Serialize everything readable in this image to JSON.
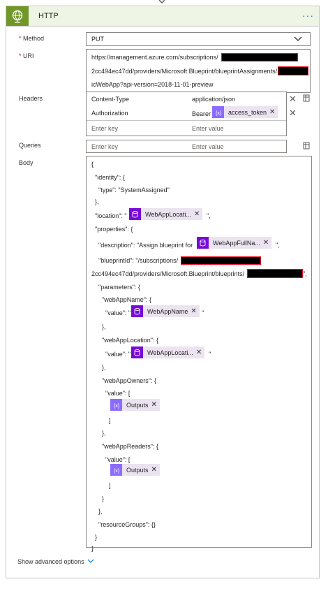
{
  "card": {
    "title": "HTTP",
    "more_label": "···",
    "icon": "globe-icon",
    "accent_color": "#709727"
  },
  "method": {
    "required_mark": "*",
    "label": "Method",
    "value": "PUT"
  },
  "uri": {
    "required_mark": "*",
    "label": "URI",
    "line1": "https://management.azure.com/subscriptions/",
    "line2": "2cc494ec47dd/providers/Microsoft.Blueprint/blueprintAssignments/",
    "line3": "icWebApp?api-version=2018-11-01-preview"
  },
  "headers": {
    "label": "Headers",
    "rows": [
      {
        "key": "Content-Type",
        "value": "application/json"
      },
      {
        "key": "Authorization",
        "value_prefix": "Bearer",
        "token": "access_token"
      }
    ],
    "key_placeholder": "Enter key",
    "value_placeholder": "Enter value",
    "delete_symbol": "✕"
  },
  "queries": {
    "label": "Queries",
    "key_placeholder": "Enter key",
    "value_placeholder": "Enter value"
  },
  "body": {
    "label": "Body",
    "l_open": "{",
    "l_identity": "\"identity\": {",
    "l_type": "\"type\": \"SystemAssigned\"",
    "l_close1": "},",
    "l_location": "\"location\": \"",
    "tok_location": "WebAppLocati...",
    "l_location_end": "\",",
    "l_properties": "\"properties\": {",
    "l_description": "\"description\": \"Assign blueprint for",
    "tok_fullname": "WebAppFullNa...",
    "l_description_end": "\",",
    "l_blueprintid": "\"blueprintId\": \"/subscriptions/",
    "l_bp_line2": "2cc494ec47dd/providers/Microsoft.Blueprint/blueprints/",
    "l_bp_line2_end": "\",",
    "l_parameters": "\"parameters\": {",
    "l_webappname": "\"webAppName\": {",
    "l_value_q": "\"value\": \"",
    "tok_webappname": "WebAppName",
    "l_value_q_end": "\"",
    "l_close2": "},",
    "l_webapplocation": "\"webAppLocation\": {",
    "l_value_q2": "\"value\": \"",
    "tok_webapplocation": "WebAppLocati...",
    "l_value_q2_end": "\"",
    "l_close3": "},",
    "l_owners": "\"webAppOwners\": {",
    "l_value_arr": "\"value\": [",
    "tok_outputs1": "Outputs",
    "l_arr_close1": "]",
    "l_close4": "},",
    "l_readers": "\"webAppReaders\": {",
    "l_value_arr2": "\"value\": [",
    "tok_outputs2": "Outputs",
    "l_arr_close2": "]",
    "l_close5": "}",
    "l_close6": "},",
    "l_resourcegroups": "\"resourceGroups\": {}",
    "l_close7": "}",
    "l_close8": "}"
  },
  "footer": {
    "show_advanced": "Show advanced options"
  }
}
